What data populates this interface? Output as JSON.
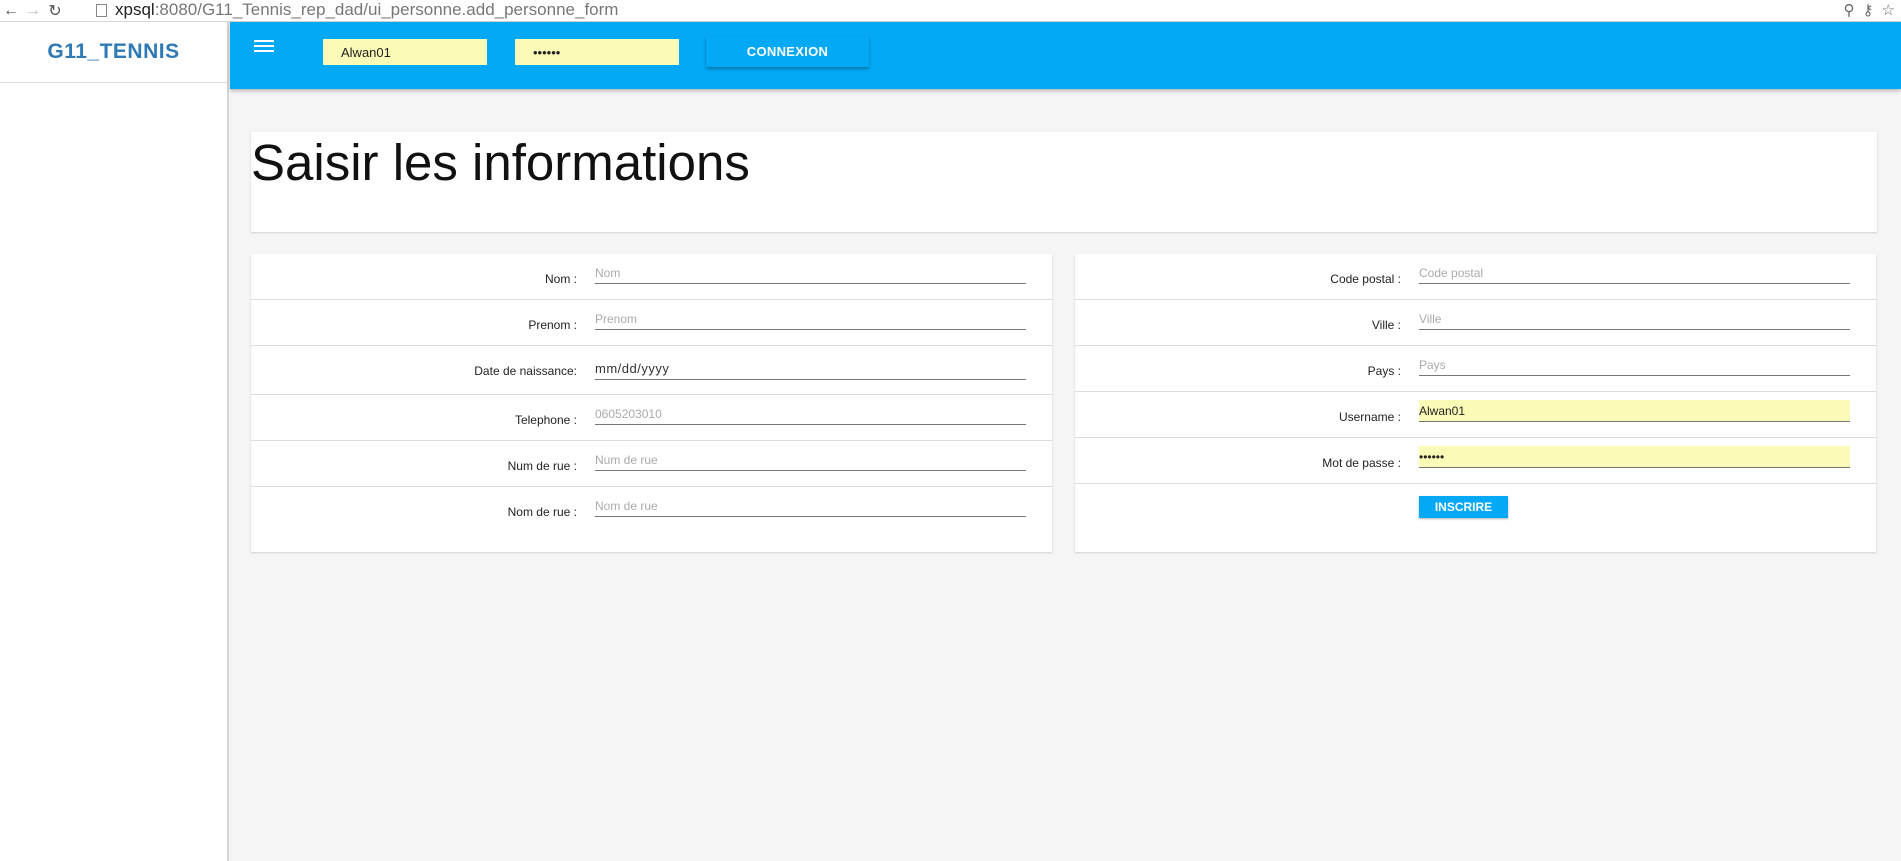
{
  "browser": {
    "url_host": "xpsql",
    "url_rest": ":8080/G11_Tennis_rep_dad/ui_personne.add_personne_form"
  },
  "sidebar": {
    "brand": "G11_TENNIS",
    "brand_color": "#2f7ab5"
  },
  "topbar": {
    "color": "#03a9f4",
    "username_value": "Alwan01",
    "password_value": "••••••",
    "connexion_label": "CONNEXION"
  },
  "page": {
    "title": "Saisir les informations"
  },
  "form_left": [
    {
      "label": "Nom :",
      "placeholder": "Nom",
      "value": ""
    },
    {
      "label": "Prenom :",
      "placeholder": "Prenom",
      "value": ""
    },
    {
      "label": "Date de naissance:",
      "placeholder": "",
      "value": "mm/dd/yyyy"
    },
    {
      "label": "Telephone :",
      "placeholder": "0605203010",
      "value": ""
    },
    {
      "label": "Num de rue :",
      "placeholder": "Num de rue",
      "value": ""
    },
    {
      "label": "Nom de rue :",
      "placeholder": "Nom de rue",
      "value": ""
    }
  ],
  "form_right": [
    {
      "label": "Code postal :",
      "placeholder": "Code postal",
      "value": ""
    },
    {
      "label": "Ville :",
      "placeholder": "Ville",
      "value": ""
    },
    {
      "label": "Pays :",
      "placeholder": "Pays",
      "value": ""
    },
    {
      "label": "Username :",
      "placeholder": "",
      "value": "Alwan01"
    },
    {
      "label": "Mot de passe :",
      "placeholder": "",
      "value": "••••••"
    }
  ],
  "submit_label": "INSCRIRE"
}
